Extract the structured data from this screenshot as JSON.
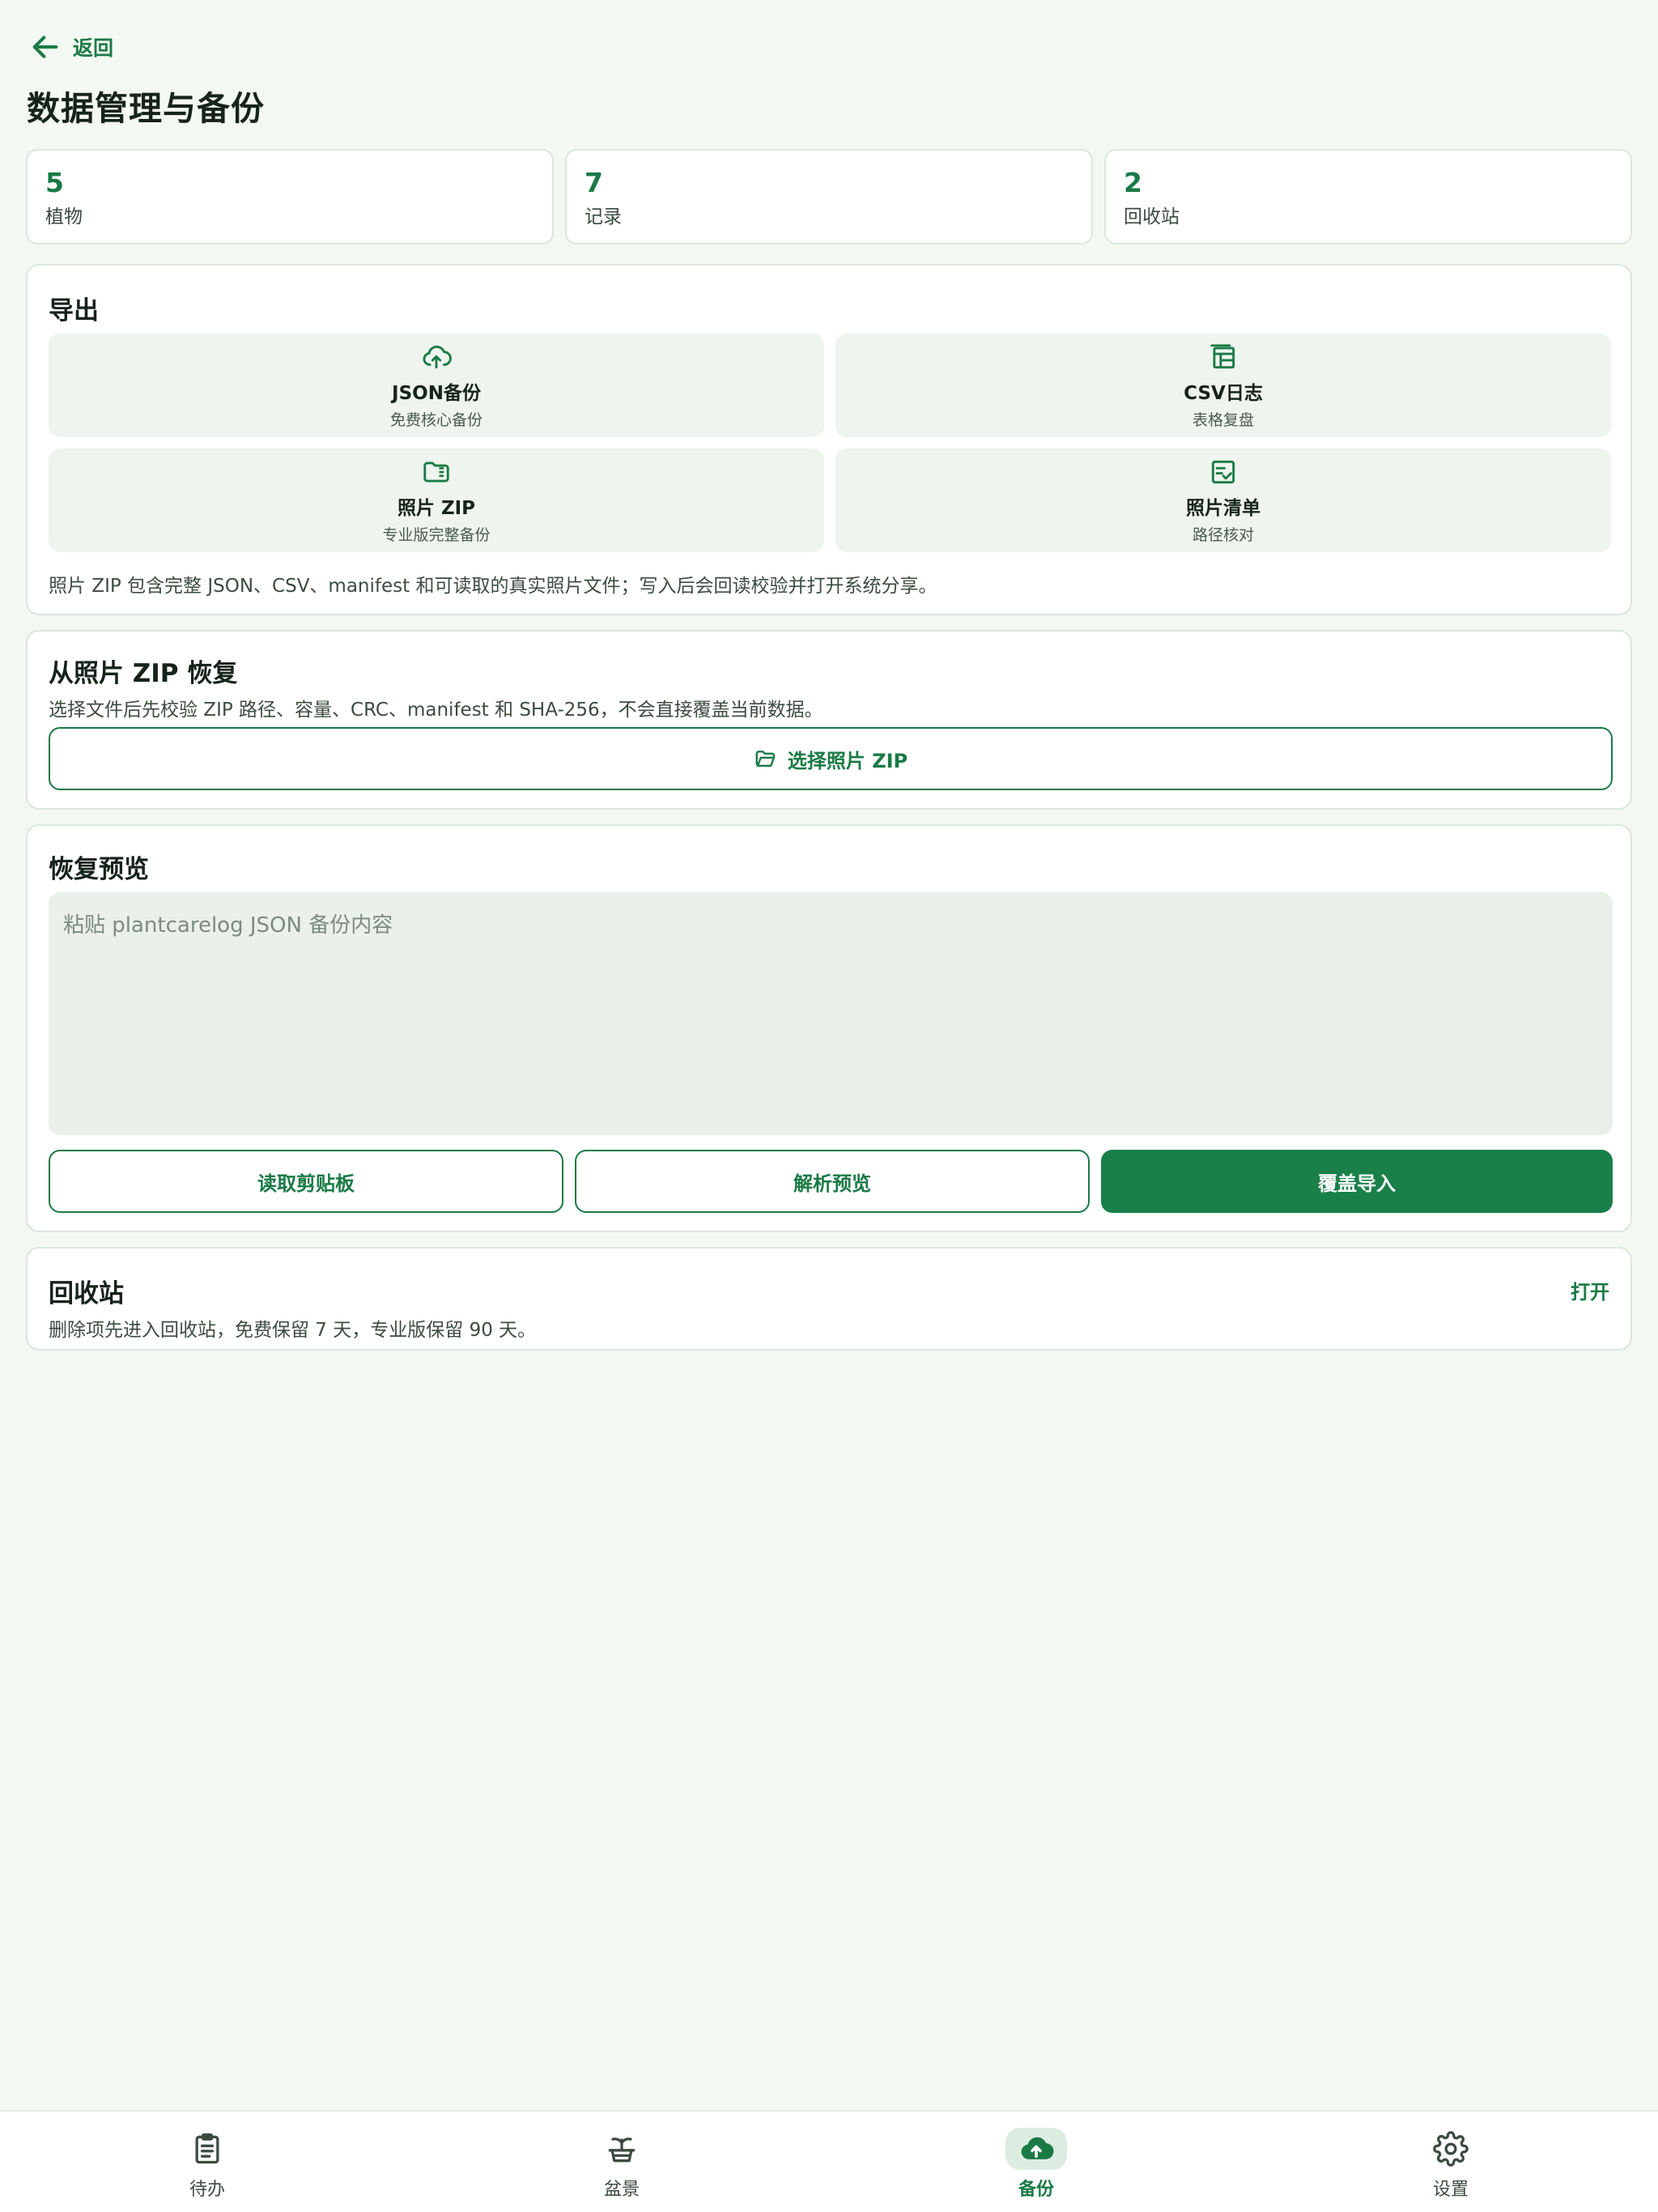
{
  "header": {
    "back_label": "返回",
    "title": "数据管理与备份"
  },
  "stats": [
    {
      "value": "5",
      "label": "植物"
    },
    {
      "value": "7",
      "label": "记录"
    },
    {
      "value": "2",
      "label": "回收站"
    }
  ],
  "export": {
    "title": "导出",
    "tiles": [
      {
        "icon": "cloud-upload-icon",
        "title": "JSON备份",
        "subtitle": "免费核心备份"
      },
      {
        "icon": "table-icon",
        "title": "CSV日志",
        "subtitle": "表格复盘"
      },
      {
        "icon": "folder-zip-icon",
        "title": "照片 ZIP",
        "subtitle": "专业版完整备份"
      },
      {
        "icon": "checklist-icon",
        "title": "照片清单",
        "subtitle": "路径核对"
      }
    ],
    "note": "照片 ZIP 包含完整 JSON、CSV、manifest 和可读取的真实照片文件；写入后会回读校验并打开系统分享。"
  },
  "restore_zip": {
    "title": "从照片 ZIP 恢复",
    "subtitle": "选择文件后先校验 ZIP 路径、容量、CRC、manifest 和 SHA-256，不会直接覆盖当前数据。",
    "button_label": "选择照片 ZIP"
  },
  "restore_preview": {
    "title": "恢复预览",
    "placeholder": "粘贴 plantcarelog JSON 备份内容",
    "value": "",
    "buttons": {
      "read_clipboard": "读取剪贴板",
      "parse_preview": "解析预览",
      "overwrite_import": "覆盖导入"
    }
  },
  "recycle_bin": {
    "title": "回收站",
    "subtitle": "删除项先进入回收站，免费保留 7 天，专业版保留 90 天。",
    "open_label": "打开"
  },
  "bottom_nav": {
    "items": [
      {
        "icon": "clipboard-icon",
        "label": "待办"
      },
      {
        "icon": "plant-pot-icon",
        "label": "盆景"
      },
      {
        "icon": "cloud-upload-icon",
        "label": "备份"
      },
      {
        "icon": "gear-icon",
        "label": "设置"
      }
    ],
    "active_index": 2
  },
  "colors": {
    "accent": "#1a7a45",
    "background": "#f4f8f3",
    "tile_background": "#eef4ee",
    "active_nav_background": "#dcece0"
  }
}
